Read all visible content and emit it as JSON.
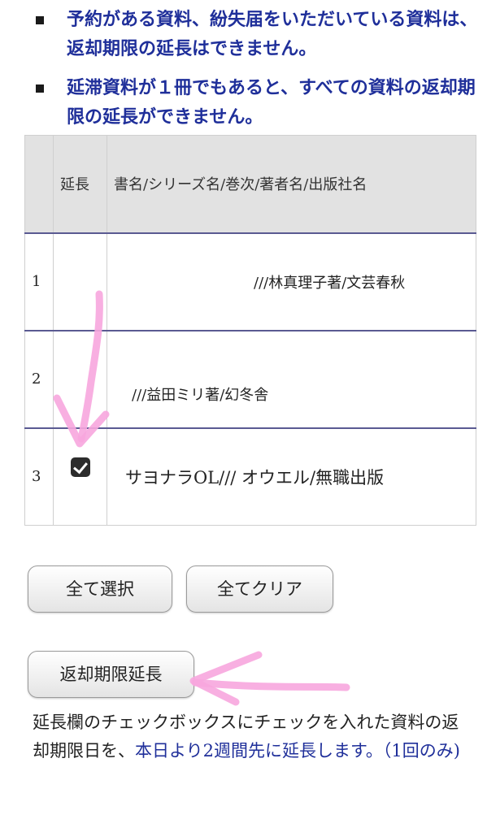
{
  "notes": [
    "予約がある資料、紛失届をいただいている資料は、返却期限の延長はできません。",
    "延滞資料が１冊でもあると、すべての資料の返却期限の延長ができません。"
  ],
  "table": {
    "headers": [
      "",
      "延長",
      "書名/シリーズ名/巻次/著者名/出版社名"
    ],
    "rows": [
      {
        "no": "1",
        "checked": false,
        "title": "///林真理子著/文芸春秋"
      },
      {
        "no": "2",
        "checked": false,
        "title": "///益田ミリ著/幻冬舎"
      },
      {
        "no": "3",
        "checked": true,
        "title": "サヨナラOL/// オウエル/無職出版"
      }
    ]
  },
  "buttons": {
    "select_all": "全て選択",
    "clear_all": "全てクリア",
    "extend": "返却期限延長"
  },
  "description": {
    "part1": "延長欄のチェックボックスにチェックを入れた資料の返却期限日を、",
    "part2": "本日より2週間先に延長します。（1回のみ)"
  },
  "colors": {
    "note_text": "#1f2f9a",
    "annotation": "#f7a6de",
    "header_bg": "#e2e2e2"
  }
}
